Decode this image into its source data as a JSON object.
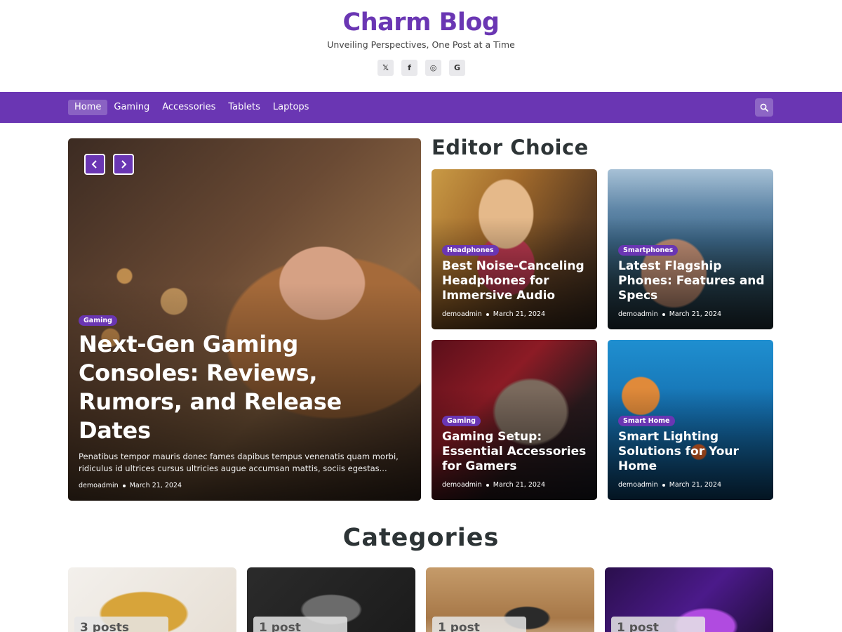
{
  "site": {
    "title": "Charm Blog",
    "tagline": "Unveiling Perspectives, One Post at a Time"
  },
  "socials": [
    {
      "icon": "x-twitter-icon",
      "glyph": "𝕏"
    },
    {
      "icon": "facebook-icon",
      "glyph": "f"
    },
    {
      "icon": "instagram-icon",
      "glyph": "◎"
    },
    {
      "icon": "google-icon",
      "glyph": "G"
    }
  ],
  "nav": {
    "items": [
      "Home",
      "Gaming",
      "Accessories",
      "Tablets",
      "Laptops"
    ],
    "active": "Home",
    "search_icon": "search-icon"
  },
  "hero": {
    "badge": "Gaming",
    "title": "Next-Gen Gaming Consoles: Reviews, Rumors, and Release Dates",
    "excerpt": "Penatibus tempor mauris donec fames dapibus tempus venenatis quam morbi, ridiculus id ultrices cursus ultricies augue accumsan mattis, sociis egestas...",
    "author": "demoadmin",
    "date": "March 21, 2024"
  },
  "editor_choice": {
    "heading": "Editor Choice",
    "cards": [
      {
        "badge": "Headphones",
        "title": "Best Noise-Canceling Headphones for Immersive Audio",
        "author": "demoadmin",
        "date": "March 21, 2024"
      },
      {
        "badge": "Smartphones",
        "title": "Latest Flagship Phones: Features and Specs",
        "author": "demoadmin",
        "date": "March 21, 2024"
      },
      {
        "badge": "Gaming",
        "title": "Gaming Setup: Essential Accessories for Gamers",
        "author": "demoadmin",
        "date": "March 21, 2024"
      },
      {
        "badge": "Smart Home",
        "title": "Smart Lighting Solutions for Your Home",
        "author": "demoadmin",
        "date": "March 21, 2024"
      }
    ]
  },
  "categories": {
    "heading": "Categories",
    "items": [
      {
        "count": "3 posts"
      },
      {
        "count": "1 post"
      },
      {
        "count": "1 post"
      },
      {
        "count": "1 post"
      }
    ]
  },
  "colors": {
    "brand": "#6a36b3",
    "text_dark": "#2d3436"
  }
}
